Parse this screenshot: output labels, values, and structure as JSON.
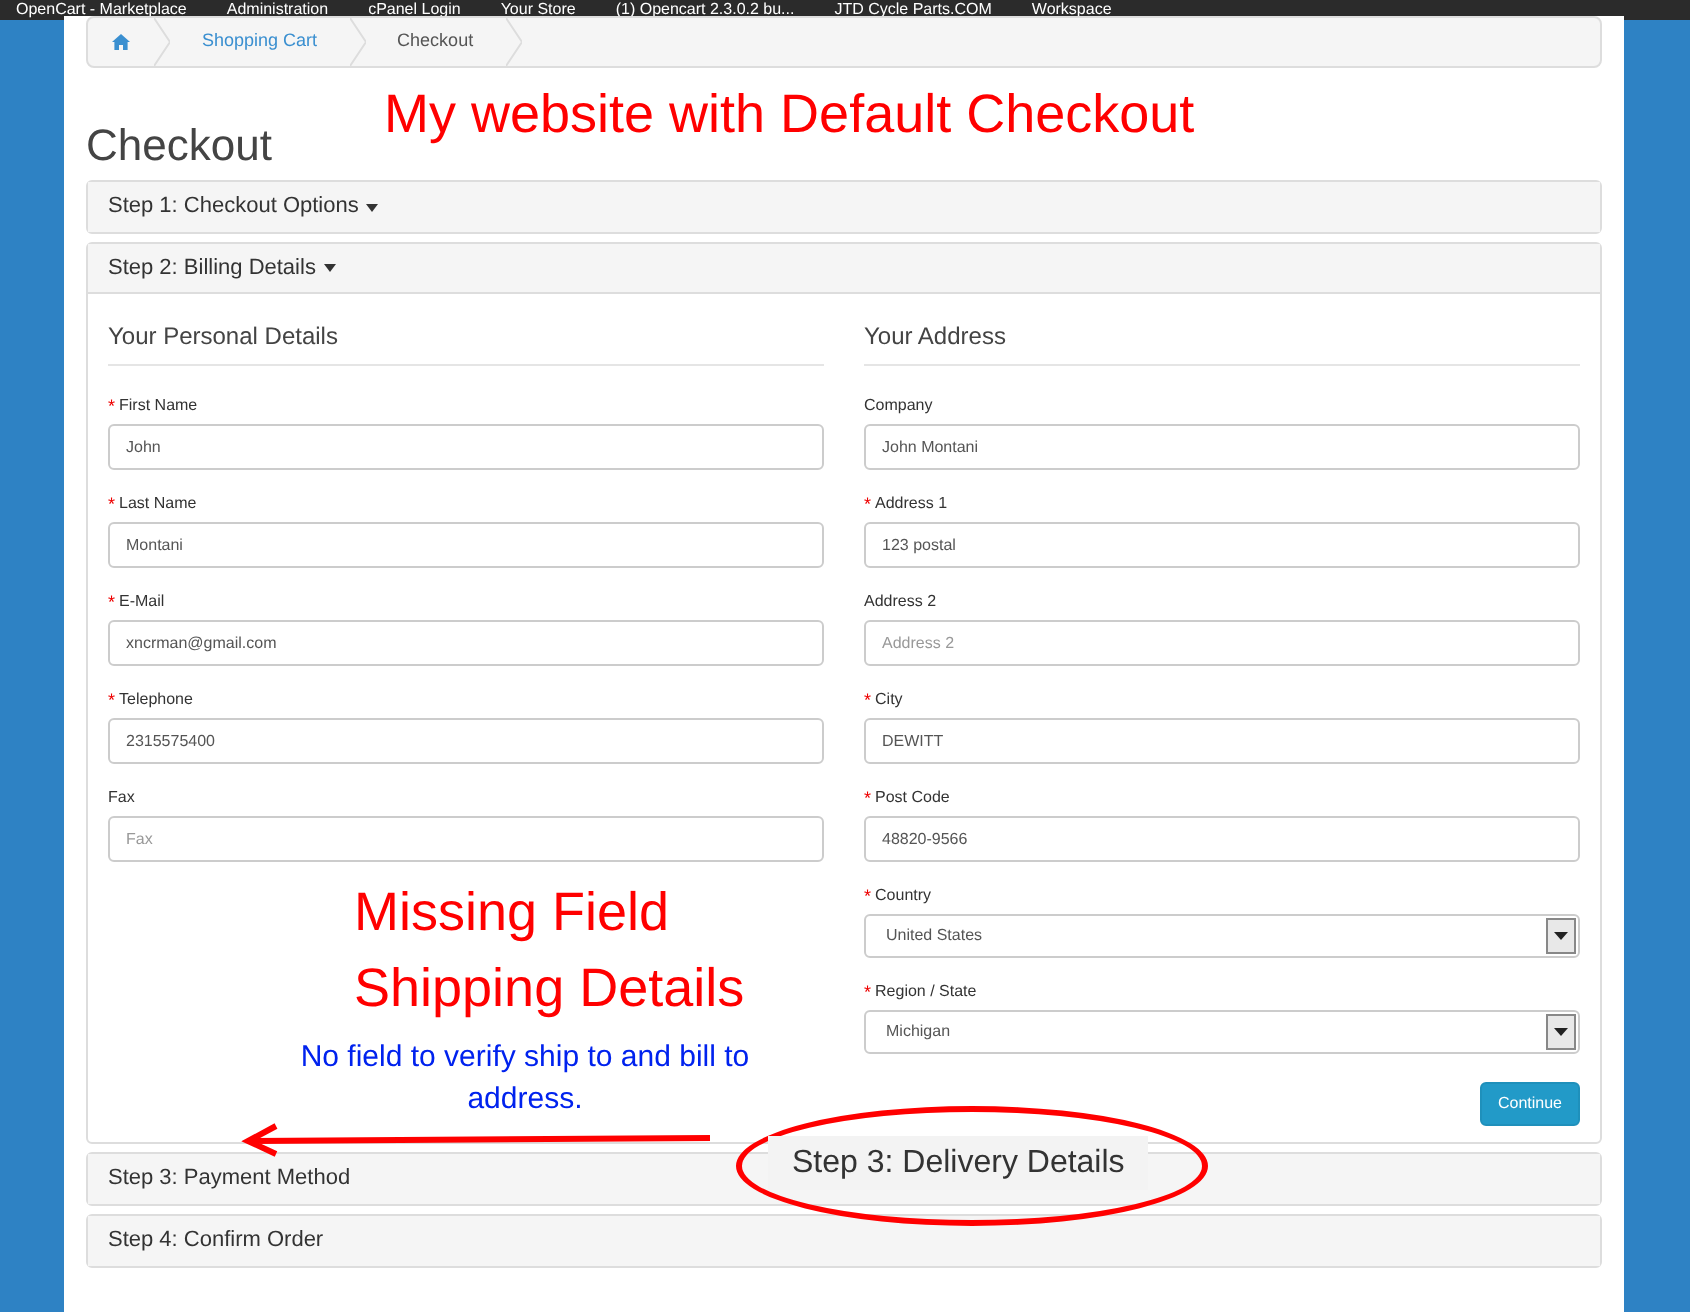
{
  "bookmarks": [
    {
      "label": "OpenCart - Marketplace"
    },
    {
      "label": "Administration"
    },
    {
      "label": "cPanel Login"
    },
    {
      "label": "Your Store"
    },
    {
      "label": "(1) Opencart 2.3.0.2 bu..."
    },
    {
      "label": "JTD Cycle Parts.COM"
    },
    {
      "label": "Workspace"
    }
  ],
  "breadcrumb": [
    {
      "kind": "home"
    },
    {
      "kind": "link",
      "label": "Shopping Cart"
    },
    {
      "kind": "current",
      "label": "Checkout"
    }
  ],
  "page_title": "Checkout",
  "steps": [
    {
      "label": "Step 1: Checkout Options",
      "caret": true,
      "expanded": false
    },
    {
      "label": "Step 2: Billing Details",
      "caret": true,
      "expanded": true
    },
    {
      "label": "Step 3: Payment Method",
      "caret": false,
      "expanded": false
    },
    {
      "label": "Step 4: Confirm Order",
      "caret": false,
      "expanded": false
    }
  ],
  "billing": {
    "columns": [
      {
        "heading": "Your Personal Details",
        "fields": [
          {
            "label": "First Name",
            "marker": "*",
            "kind": "text",
            "value": "John"
          },
          {
            "label": "Last Name",
            "marker": "*",
            "kind": "text",
            "value": "Montani"
          },
          {
            "label": "E-Mail",
            "marker": "*",
            "kind": "text",
            "value": "xncrman@gmail.com"
          },
          {
            "label": "Telephone",
            "marker": "*",
            "kind": "text",
            "value": "2315575400"
          },
          {
            "label": "Fax",
            "kind": "text",
            "placeholder": "Fax"
          }
        ]
      },
      {
        "heading": "Your Address",
        "fields": [
          {
            "label": "Company",
            "kind": "text",
            "value": "John Montani"
          },
          {
            "label": "Address 1",
            "marker": "*",
            "kind": "text",
            "value": "123 postal"
          },
          {
            "label": "Address 2",
            "kind": "text",
            "placeholder": "Address 2"
          },
          {
            "label": "City",
            "marker": "*",
            "kind": "text",
            "value": "DEWITT"
          },
          {
            "label": "Post Code",
            "marker": "*",
            "kind": "text",
            "value": "48820-9566"
          },
          {
            "label": "Country",
            "marker": "*",
            "kind": "select",
            "value": "United States"
          },
          {
            "label": "Region / State",
            "marker": "*",
            "kind": "select",
            "value": "Michigan"
          }
        ]
      }
    ],
    "button": "Continue"
  },
  "annotations": {
    "title": "My website with Default Checkout",
    "missing": [
      "Missing Field",
      "Shipping Details"
    ],
    "note": "No field to verify ship to and bill to address.",
    "callout": "Step 3: Delivery Details"
  }
}
